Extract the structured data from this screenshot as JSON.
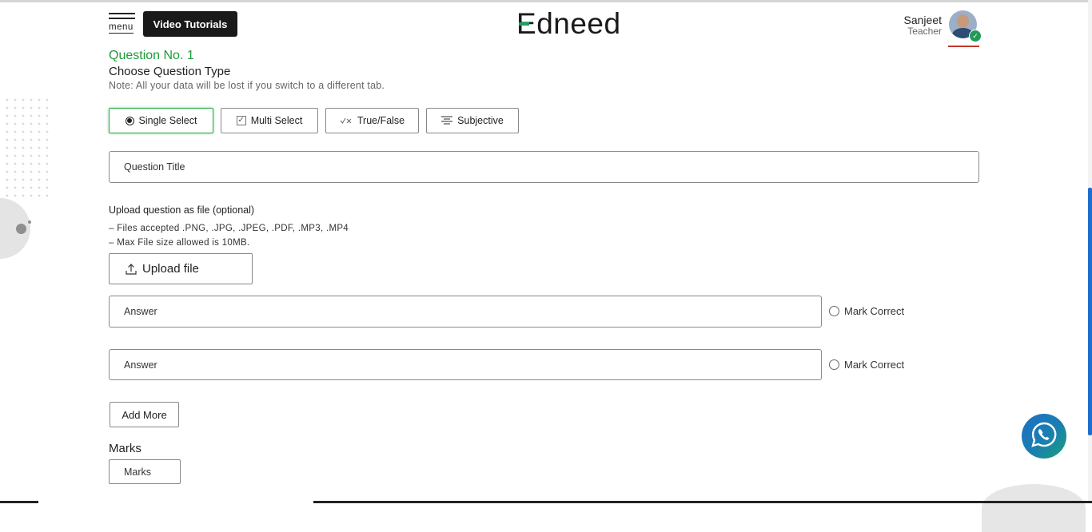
{
  "header": {
    "menu_label": "menu",
    "video_tutorials_label": "Video Tutorials",
    "logo_text": "dneed",
    "logo_first_letter": "E",
    "user": {
      "name": "Sanjeet",
      "role": "Teacher"
    }
  },
  "question": {
    "number_label": "Question No. 1",
    "type_heading": "Choose Question Type",
    "note": "Note: All your data will be lost if you switch to a different tab.",
    "types": [
      {
        "label": "Single Select",
        "icon": "radio-filled-icon",
        "selected": true
      },
      {
        "label": "Multi Select",
        "icon": "checkbox-icon",
        "selected": false
      },
      {
        "label": "True/False",
        "icon": "true-false-icon",
        "selected": false
      },
      {
        "label": "Subjective",
        "icon": "align-center-icon",
        "selected": false
      }
    ],
    "title_placeholder": "Question Title"
  },
  "upload": {
    "title": "Upload question as file (optional)",
    "info_files": "–  Files accepted .PNG, .JPG, .JPEG, .PDF, .MP3, .MP4",
    "info_size": "–  Max File size allowed is 10MB.",
    "button_label": "Upload file"
  },
  "answers": [
    {
      "placeholder": "Answer",
      "mark_label": "Mark Correct"
    },
    {
      "placeholder": "Answer",
      "mark_label": "Mark Correct"
    }
  ],
  "add_more_label": "Add More",
  "marks": {
    "label": "Marks",
    "placeholder": "Marks"
  },
  "colors": {
    "accent_green": "#1e9b3b",
    "dark": "#1a1a1a",
    "scroll_blue": "#1b6fd1"
  }
}
